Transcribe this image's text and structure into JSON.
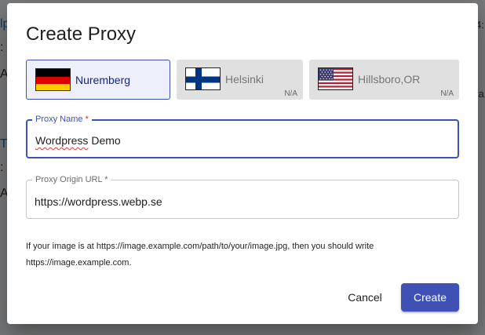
{
  "dialog": {
    "title": "Create Proxy",
    "locations": [
      {
        "name": "Nuremberg",
        "flag": "germany-flag",
        "selected": true,
        "status": ""
      },
      {
        "name": "Helsinki",
        "flag": "finland-flag",
        "selected": false,
        "status": "N/A"
      },
      {
        "name": "Hillsboro,OR",
        "flag": "usa-flag",
        "selected": false,
        "status": "N/A"
      }
    ],
    "proxy_name": {
      "label": "Proxy Name",
      "required_mark": "*",
      "value_word1": "Wordpress",
      "value_rest": " Demo"
    },
    "origin_url": {
      "label": "Proxy Origin URL *",
      "value": "https://wordpress.webp.se"
    },
    "help_text": "If your image is at https://image.example.com/path/to/your/image.jpg, then you should write https://image.example.com.",
    "cancel_label": "Cancel",
    "create_label": "Create"
  },
  "colors": {
    "accent": "#3f51b5",
    "required": "#d32f2f",
    "disabled_bg": "#e0e0e0",
    "selected_bg": "#edf0fb"
  }
}
